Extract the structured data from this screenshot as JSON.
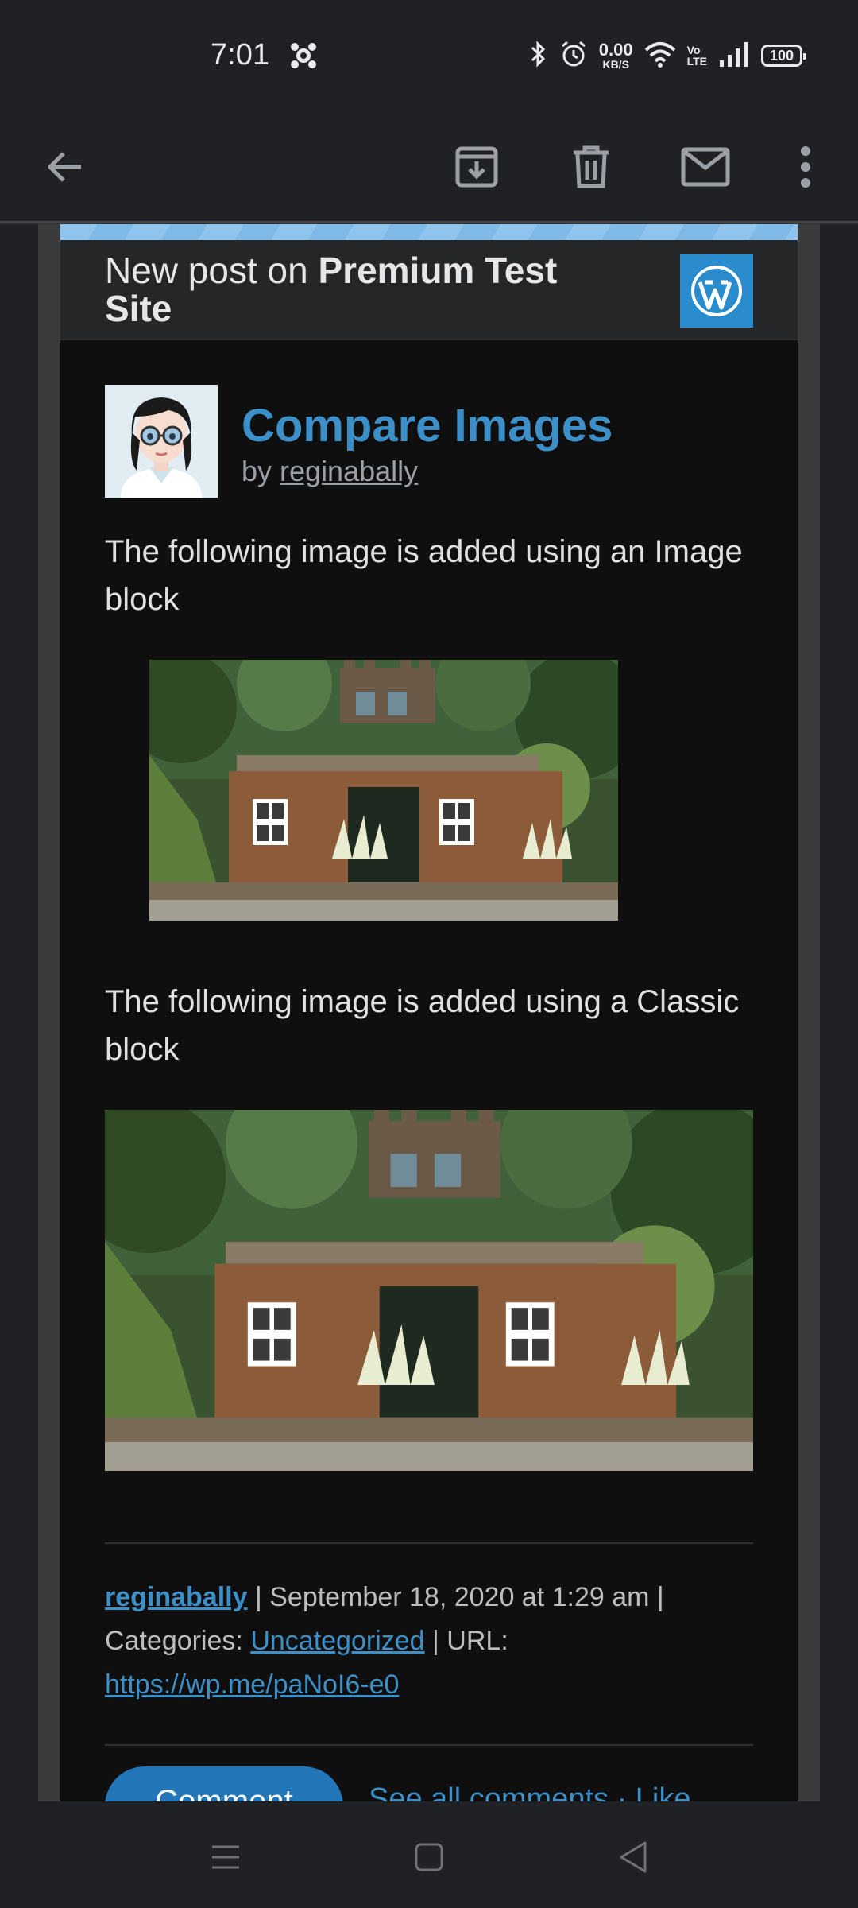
{
  "status": {
    "time": "7:01",
    "net_speed_value": "0.00",
    "net_speed_unit": "KB/S",
    "volte_top": "Vo",
    "volte_bottom": "LTE",
    "battery": "100"
  },
  "toolbar": {
    "back_icon": "arrow-left-icon",
    "archive_icon": "archive-icon",
    "delete_icon": "trash-icon",
    "mark_unread_icon": "mail-icon",
    "more_icon": "more-vertical-icon"
  },
  "email": {
    "header_prefix": "New post on ",
    "site_name": "Premium Test Site",
    "post_title": "Compare Images",
    "by_prefix": "by ",
    "author": "reginabally",
    "para1": "The following image is added using an Image block",
    "para2": "The following image is added using a Classic block",
    "meta_author": "reginabally",
    "meta_date": " | September 18, 2020 at 1:29 am |",
    "meta_categories_label": "Categories: ",
    "meta_category": "Uncategorized",
    "meta_url_label": " | URL:",
    "meta_url": "https://wp.me/paNoI6-e0",
    "comment_button": "Comment",
    "see_all": "See all comments · Like"
  },
  "colors": {
    "accent": "#3d8fc7",
    "wp_brand": "#2a8ccd",
    "background": "#202124"
  }
}
